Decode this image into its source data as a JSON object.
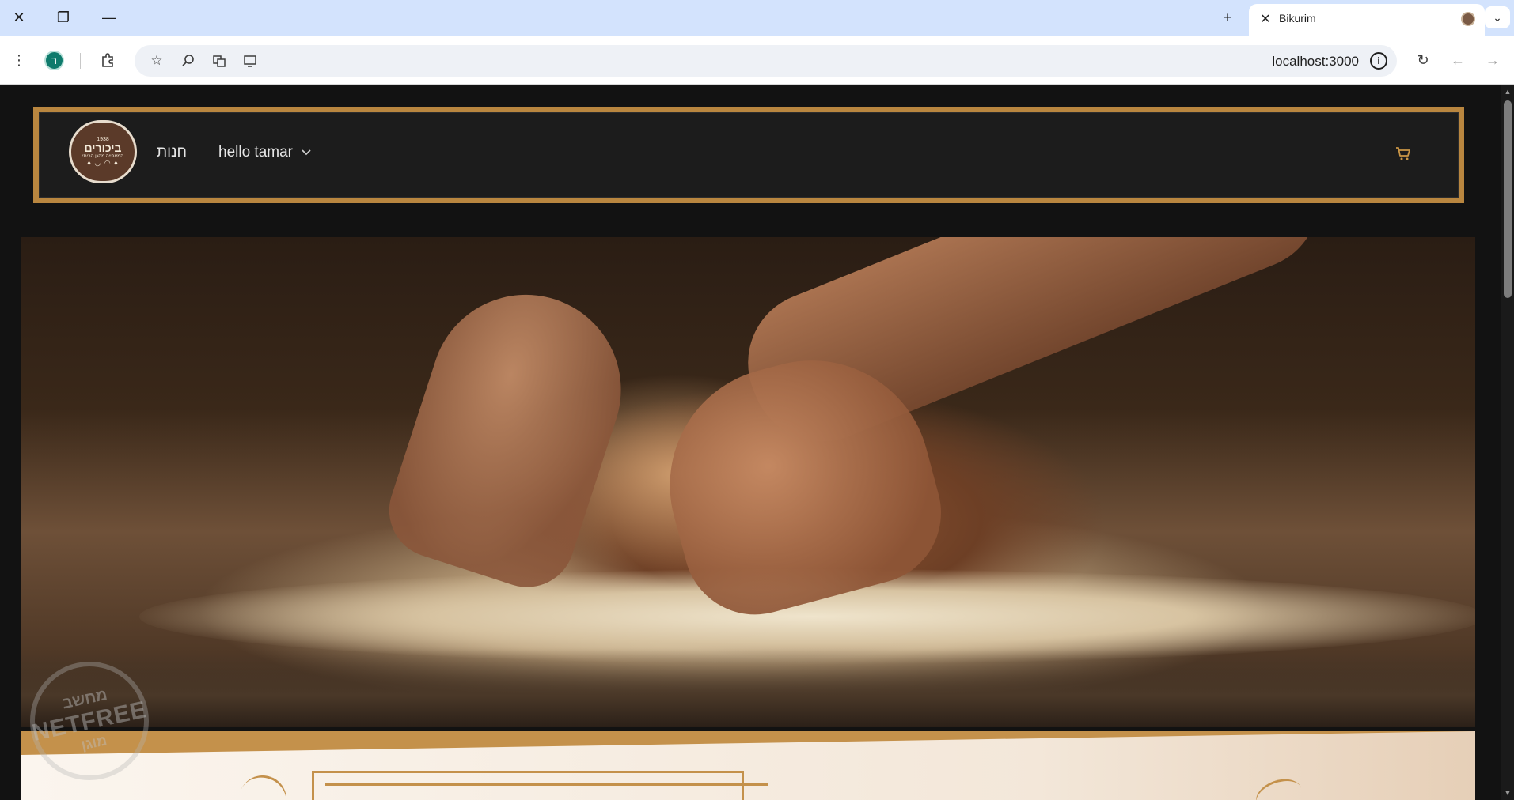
{
  "browser": {
    "tab": {
      "title": "Bikurim"
    },
    "address_bar": {
      "url": "localhost:3000"
    },
    "profile_initial": "ר"
  },
  "site": {
    "logo": {
      "line1": "1938",
      "line2": "ביכורים",
      "line3": "המאפייה מהגן הביתי",
      "line4": "♦ ◡ ◠ ♦"
    },
    "nav": {
      "store_label": "חנות",
      "user_greeting": "hello tamar"
    },
    "accent_color": "#b9863f"
  },
  "watermark": {
    "line1": "מחשב",
    "line2": "NETFREE",
    "line3": "מוגן"
  }
}
